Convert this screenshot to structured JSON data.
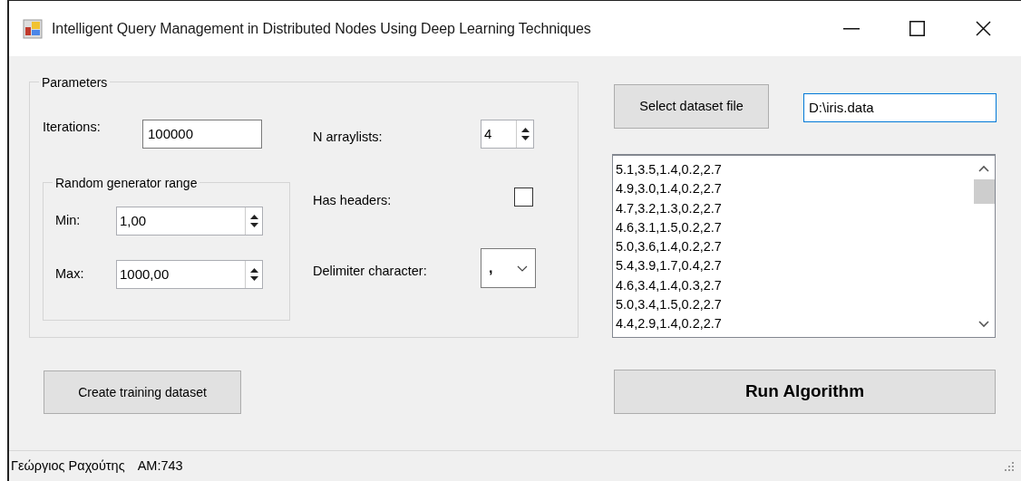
{
  "window": {
    "title": "Intelligent Query Management in Distributed Nodes Using Deep Learning Techniques"
  },
  "parameters": {
    "title": "Parameters",
    "iterations": {
      "label": "Iterations:",
      "value": "100000"
    },
    "random_range": {
      "title": "Random generator range",
      "min": {
        "label": "Min:",
        "value": "1,00"
      },
      "max": {
        "label": "Max:",
        "value": "1000,00"
      }
    },
    "n_arraylists": {
      "label": "N arraylists:",
      "value": "4"
    },
    "has_headers": {
      "label": "Has headers:",
      "checked": false
    },
    "delimiter": {
      "label": "Delimiter character:",
      "value": ","
    }
  },
  "create_button": "Create training dataset",
  "dataset": {
    "select_button": "Select dataset file",
    "path": {
      "value": "D:\\iris.data",
      "focused": true
    },
    "lines": [
      "5.1,3.5,1.4,0.2,2.7",
      "4.9,3.0,1.4,0.2,2.7",
      "4.7,3.2,1.3,0.2,2.7",
      "4.6,3.1,1.5,0.2,2.7",
      "5.0,3.6,1.4,0.2,2.7",
      "5.4,3.9,1.7,0.4,2.7",
      "4.6,3.4,1.4,0.3,2.7",
      "5.0,3.4,1.5,0.2,2.7",
      "4.4,2.9,1.4,0.2,2.7"
    ]
  },
  "run_button": "Run Algorithm",
  "status_bar": [
    "Γεώργιος Ραχούτης",
    "AM:743"
  ]
}
